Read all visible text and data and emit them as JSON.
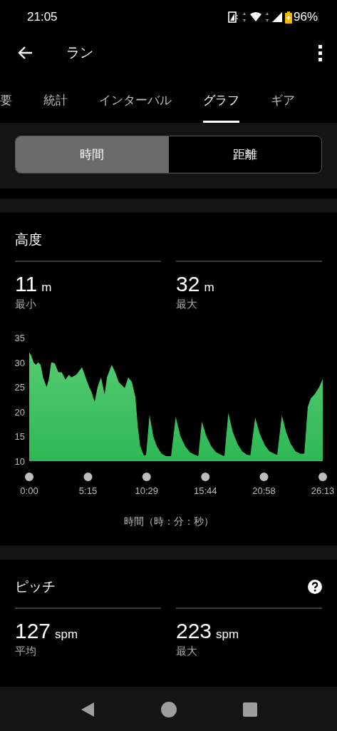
{
  "status_bar": {
    "time": "21:05",
    "battery": "96%"
  },
  "app_bar": {
    "title": "ラン"
  },
  "tabs": [
    {
      "label": "要",
      "selected": false
    },
    {
      "label": "統計",
      "selected": false
    },
    {
      "label": "インターバル",
      "selected": false
    },
    {
      "label": "グラフ",
      "selected": true
    },
    {
      "label": "ギア",
      "selected": false
    }
  ],
  "toggle": [
    {
      "label": "時間",
      "selected": true
    },
    {
      "label": "距離",
      "selected": false
    }
  ],
  "sections": [
    {
      "title": "高度",
      "help": false,
      "stats": [
        {
          "value": "11",
          "unit": "m",
          "label": "最小"
        },
        {
          "value": "32",
          "unit": "m",
          "label": "最大"
        }
      ],
      "chart_data": {
        "type": "area",
        "xlabel": "時間（時：分：秒）",
        "xlim": [
          0,
          1573
        ],
        "ylim": [
          10,
          35
        ],
        "xticks": [
          {
            "value": 0,
            "label": "0:00"
          },
          {
            "value": 315,
            "label": "5:15"
          },
          {
            "value": 629,
            "label": "10:29"
          },
          {
            "value": 944,
            "label": "15:44"
          },
          {
            "value": 1258,
            "label": "20:58"
          },
          {
            "value": 1573,
            "label": "26:13"
          }
        ],
        "yticks": [
          10,
          15,
          20,
          25,
          30,
          35
        ],
        "x": [
          0,
          10,
          23,
          36,
          48,
          61,
          74,
          93,
          105,
          118,
          137,
          156,
          175,
          194,
          213,
          226,
          252,
          283,
          302,
          321,
          334,
          351,
          366,
          385,
          404,
          417,
          442,
          461,
          480,
          493,
          512,
          531,
          550,
          569,
          582,
          595,
          614,
          626,
          645,
          665,
          684,
          709,
          734,
          760,
          785,
          811,
          836,
          861,
          887,
          906,
          925,
          950,
          976,
          1001,
          1027,
          1046,
          1067,
          1090,
          1116,
          1141,
          1166,
          1185,
          1211,
          1236,
          1262,
          1287,
          1319,
          1329,
          1354,
          1376,
          1401,
          1427,
          1452,
          1474,
          1493,
          1509,
          1529,
          1554,
          1573
        ],
        "series": [
          {
            "color": "#2eb855",
            "values": [
              32,
              31.5,
              30,
              29.5,
              30,
              29.5,
              27,
              25,
              26.5,
              30,
              29.8,
              28,
              28,
              26.5,
              27.5,
              27,
              27.5,
              29,
              27,
              25,
              24,
              22,
              25,
              27,
              23.5,
              27,
              29.5,
              28,
              26,
              25.5,
              24.8,
              27,
              26,
              23,
              17,
              13,
              11.2,
              11.2,
              19.4,
              15,
              13,
              11.5,
              11,
              11,
              19,
              15,
              13,
              11.8,
              11.3,
              11,
              18,
              15,
              13,
              11.8,
              11.3,
              11,
              19.8,
              16,
              13.5,
              12,
              11.3,
              11.2,
              18.8,
              15.5,
              13.3,
              12,
              11.4,
              11.3,
              19.3,
              16,
              13.5,
              12,
              11.5,
              11.5,
              21,
              22.7,
              23.5,
              25,
              26.6
            ]
          }
        ]
      }
    },
    {
      "title": "ピッチ",
      "help": true,
      "stats": [
        {
          "value": "127",
          "unit": "spm",
          "label": "平均"
        },
        {
          "value": "223",
          "unit": "spm",
          "label": "最大"
        }
      ]
    }
  ]
}
